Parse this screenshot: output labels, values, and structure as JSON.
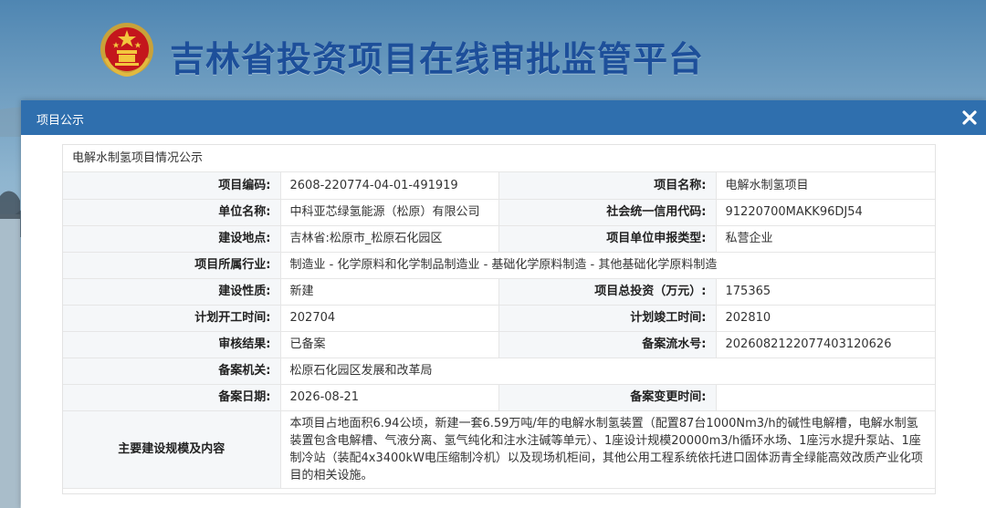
{
  "site": {
    "title": "吉林省投资项目在线审批监管平台"
  },
  "modal": {
    "title": "项目公示",
    "close_glyph": "✕"
  },
  "panel": {
    "title": "电解水制氢项目情况公示"
  },
  "fields": {
    "project_code_label": "项目编码:",
    "project_code": "2608-220774-04-01-491919",
    "project_name_label": "项目名称:",
    "project_name": "电解水制氢项目",
    "unit_name_label": "单位名称:",
    "unit_name": "中科亚芯绿氢能源（松原）有限公司",
    "credit_code_label": "社会统一信用代码:",
    "credit_code": "91220700MAKK96DJ54",
    "location_label": "建设地点:",
    "location": "吉林省:松原市_松原石化园区",
    "declare_type_label": "项目单位申报类型:",
    "declare_type": "私营企业",
    "industry_label": "项目所属行业:",
    "industry": "制造业 - 化学原料和化学制品制造业 - 基础化学原料制造 - 其他基础化学原料制造",
    "nature_label": "建设性质:",
    "nature": "新建",
    "investment_label": "项目总投资（万元）:",
    "investment": "175365",
    "start_time_label": "计划开工时间:",
    "start_time": "202704",
    "end_time_label": "计划竣工时间:",
    "end_time": "202810",
    "result_label": "审核结果:",
    "result": "已备案",
    "serial_label": "备案流水号:",
    "serial": "2026082122077403120626",
    "authority_label": "备案机关:",
    "authority": "松原石化园区发展和改革局",
    "record_date_label": "备案日期:",
    "record_date": "2026-08-21",
    "change_time_label": "备案变更时间:",
    "change_time": "",
    "scope_label": "主要建设规模及内容",
    "scope": "本项目占地面积6.94公顷，新建一套6.59万吨/年的电解水制氢装置（配置87台1000Nm3/h的碱性电解槽，电解水制氢装置包含电解槽、气液分离、氢气纯化和注水注碱等单元）、1座设计规模20000m3/h循环水场、1座污水提升泵站、1座制冷站（装配4x3400kW电压缩制冷机）以及现场机柜间，其他公用工程系统依托进口固体沥青全绿能高效改质产业化项目的相关设施。"
  },
  "colors": {
    "header_blue": "#2f6fae",
    "title_blue": "#1d4f9a",
    "label_bg": "#f5f7f9"
  }
}
